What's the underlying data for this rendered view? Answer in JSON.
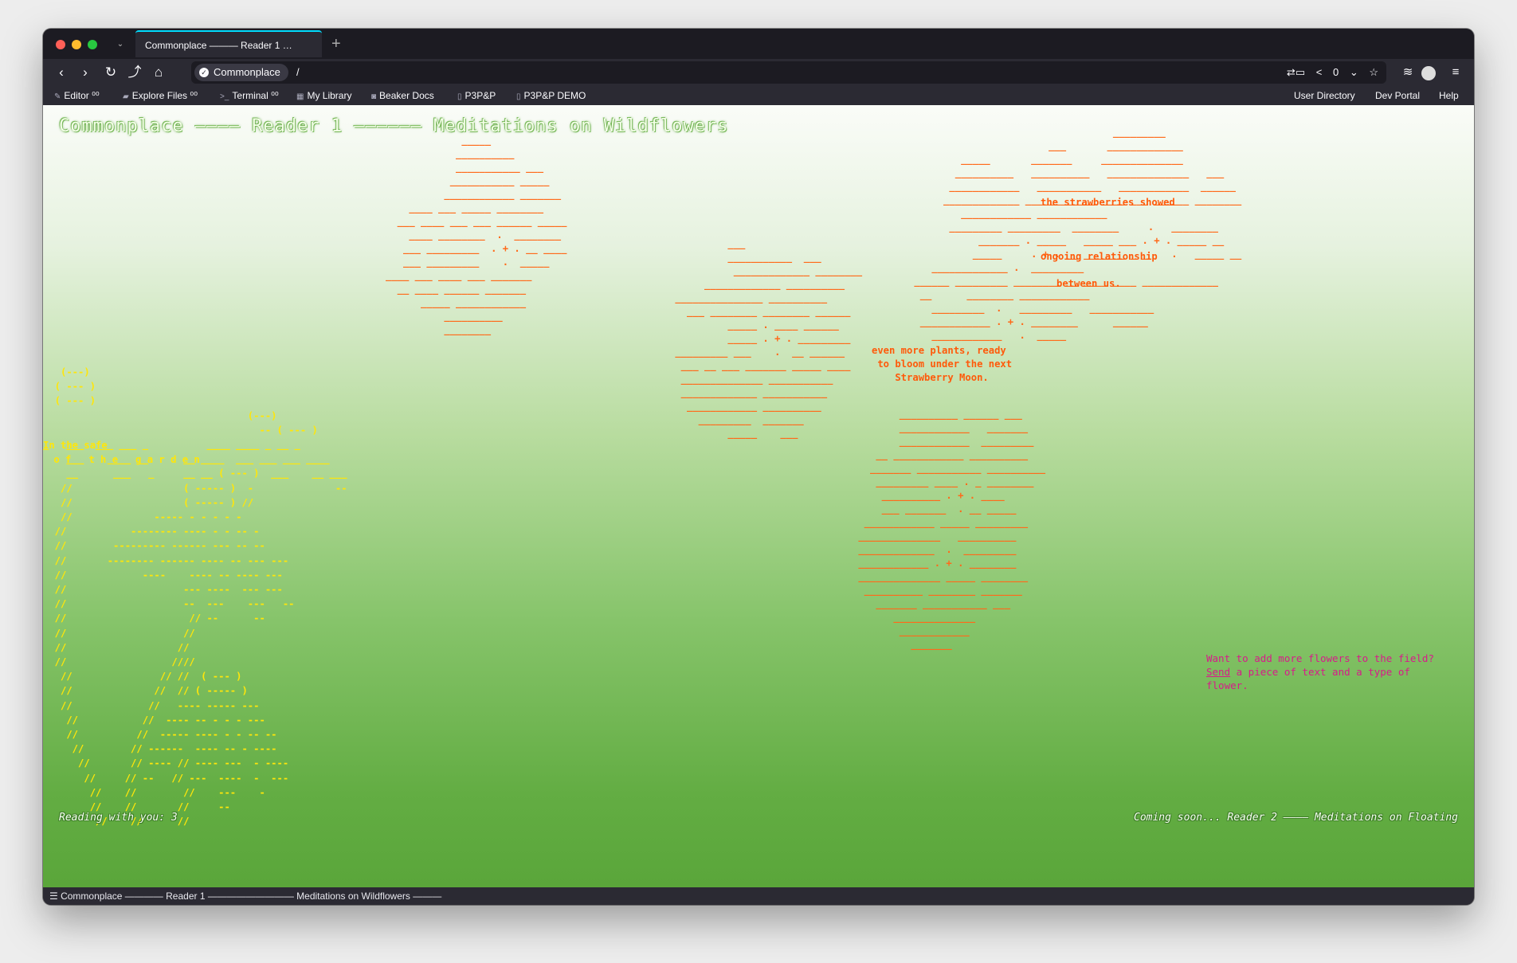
{
  "browser": {
    "tab_title": "Commonplace ——— Reader 1 …",
    "new_tab": "+",
    "tab_list": "⌄",
    "site_name": "Commonplace",
    "url_path": "/",
    "share_count": "0"
  },
  "bookmarks": [
    {
      "label": "Editor ⁰⁰",
      "icon": "pencil-icon"
    },
    {
      "label": "Explore Files ⁰⁰",
      "icon": "folder-icon"
    },
    {
      "label": "Terminal ⁰⁰",
      "icon": "terminal-icon"
    },
    {
      "label": "My Library",
      "icon": "library-icon"
    },
    {
      "label": "Beaker Docs",
      "icon": "beaker-icon"
    },
    {
      "label": "P3P&P",
      "icon": "page-icon"
    },
    {
      "label": "P3P&P DEMO",
      "icon": "page-icon"
    }
  ],
  "top_links": [
    "User Directory",
    "Dev Portal",
    "Help"
  ],
  "page": {
    "title": "Commonplace ———— Reader 1 —————— Meditations on Wildflowers",
    "poem_red": {
      "line1": "the strawberries showed",
      "line2": "ongoing relationship",
      "line3": "between us.",
      "line4": "even more plants, ready\n to bloom under the next\n    Strawberry Moon."
    },
    "poem_yellow": {
      "line1": "In the safe",
      "line2": " o f   t h e   g a r d e n"
    },
    "invite_before": "Want to add more flowers to the field? ",
    "invite_link": "Send",
    "invite_after": " a piece of text and a type of flower.",
    "reading": "Reading with you: 3",
    "coming": "Coming soon... Reader 2 ———— Meditations on Floating"
  },
  "statusbar": "☰ Commonplace ———— Reader 1 ————————— Meditations on Wildflowers ———"
}
